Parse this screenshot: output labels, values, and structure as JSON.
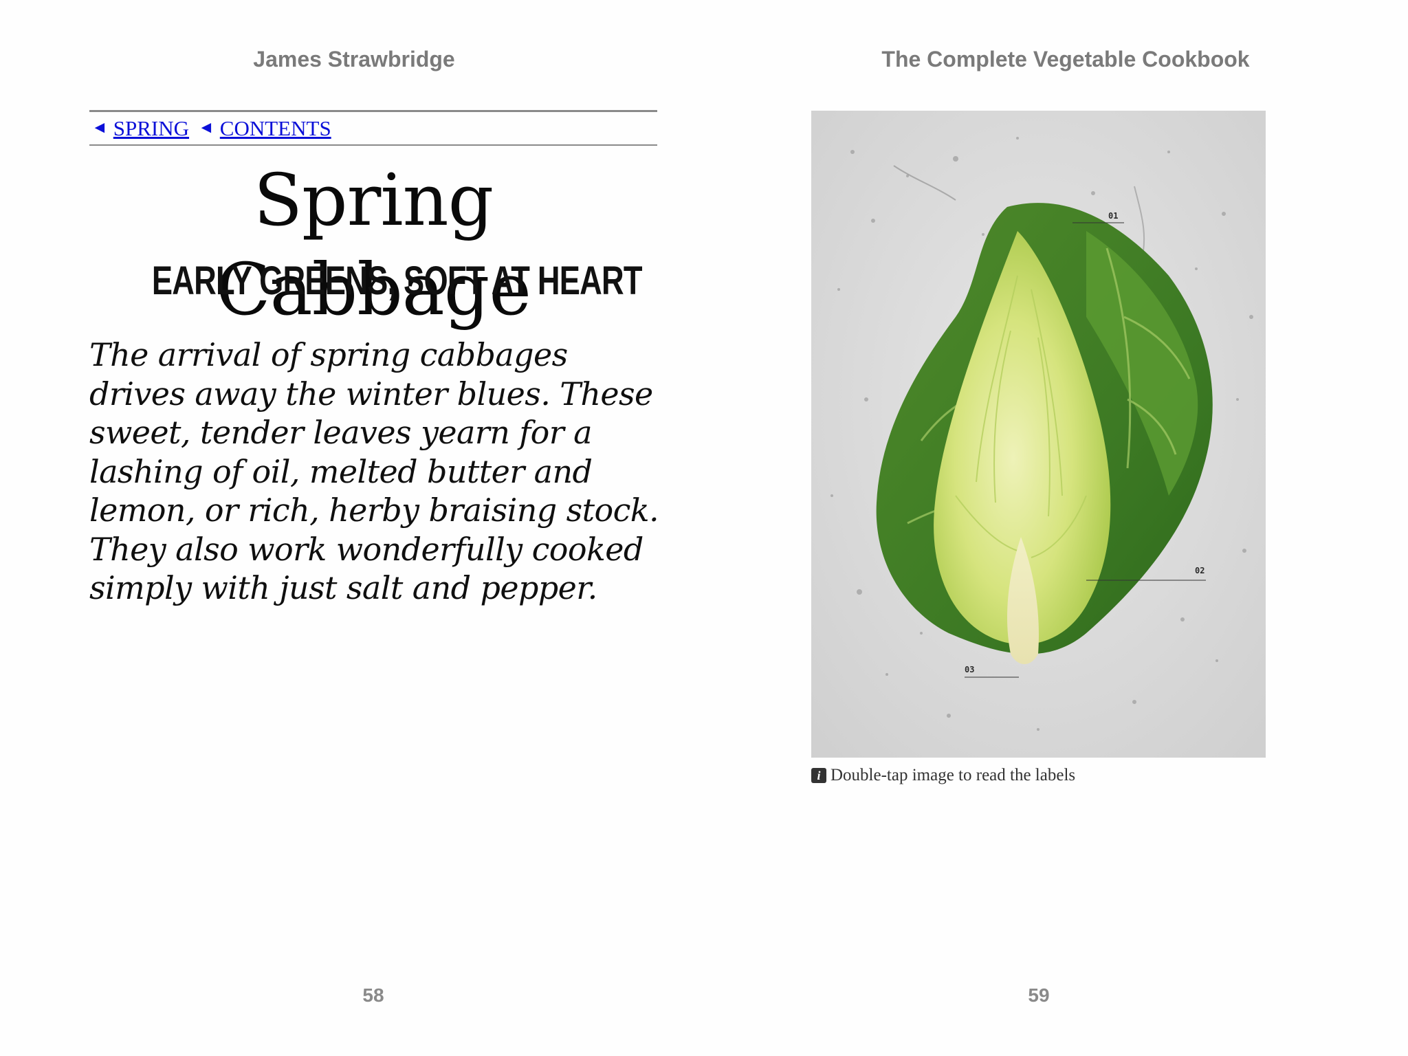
{
  "header": {
    "author": "James Strawbridge",
    "book_title": "The Complete Vegetable Cookbook"
  },
  "nav": {
    "arrow": "◄",
    "links": [
      {
        "label": "SPRING"
      },
      {
        "label": "CONTENTS"
      }
    ]
  },
  "left_page": {
    "title": "Spring Cabbage",
    "subtitle": "EARLY GREENS, SOFT AT HEART",
    "intro": "The arrival of spring cabbages drives away the winter blues. These sweet, tender leaves yearn for a lashing of oil, melted butter and lemon, or rich, herby braising stock. They also work wonderfully cooked simply with just salt and pepper.",
    "page_number": "58"
  },
  "right_page": {
    "figure": {
      "labels": [
        "01",
        "02",
        "03"
      ]
    },
    "caption_icon": "i",
    "caption": "Double-tap image to read the labels",
    "page_number": "59"
  },
  "colors": {
    "link": "#0b10d8",
    "running_head": "#7a7a7a",
    "folio": "#8a8a8a",
    "leaf_dark": "#3d7a24",
    "leaf_light": "#c9dd6e"
  },
  "icons": {
    "nav_arrow": "left-triangle-icon",
    "caption": "info-icon"
  }
}
